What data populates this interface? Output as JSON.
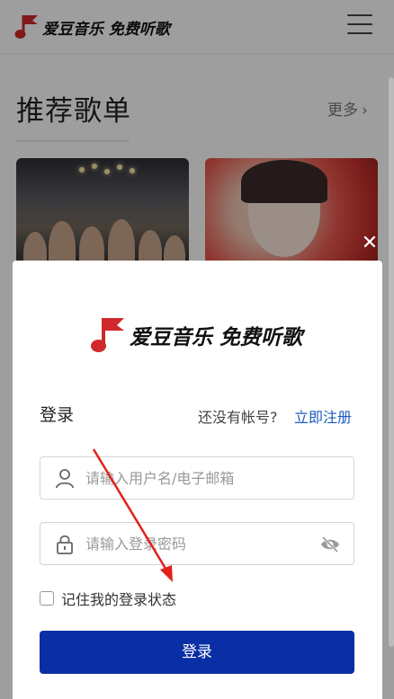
{
  "app": {
    "logo_text": "爱豆音乐 免费听歌"
  },
  "background_page": {
    "section_title": "推荐歌单",
    "more_label": "更多",
    "more_chevron": "›"
  },
  "modal": {
    "close_glyph": "✕",
    "logo_text": "爱豆音乐 免费听歌",
    "heading": "登录",
    "no_account_text": "还没有帐号?",
    "register_link": "立即注册",
    "username_placeholder": "请输入用户名/电子邮箱",
    "username_value": "",
    "password_placeholder": "请输入登录密码",
    "password_value": "",
    "remember_label": "记住我的登录状态",
    "remember_checked": false,
    "login_button": "登录"
  },
  "icons": {
    "logo": "music-note-flag-icon",
    "menu": "hamburger-menu-icon",
    "user": "user-icon",
    "lock": "lock-icon",
    "eye": "eye-off-icon",
    "close": "close-icon"
  },
  "colors": {
    "brand_red": "#d0282b",
    "primary_blue": "#0a2ea5",
    "link_blue": "#1c5bbf",
    "annotation_red": "#e3201b"
  }
}
